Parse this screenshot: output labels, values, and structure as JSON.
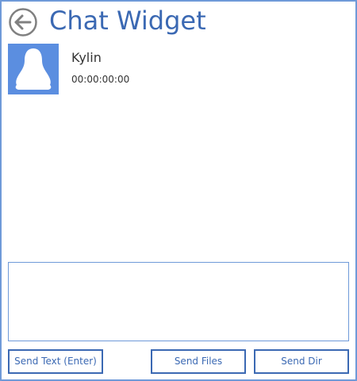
{
  "window": {
    "title": "Chat Widget",
    "accent_color": "#3b69b3",
    "border_color": "#6f9ad8"
  },
  "header": {
    "back_icon": "back-arrow-icon"
  },
  "contact": {
    "avatar_icon": "penguin-icon",
    "avatar_color": "#5b8ee0",
    "name": "Kylin",
    "time": "00:00:00:00"
  },
  "composer": {
    "value": "",
    "placeholder": ""
  },
  "actions": {
    "send_text_label": "Send Text (Enter)",
    "send_files_label": "Send Files",
    "send_dir_label": "Send Dir"
  }
}
